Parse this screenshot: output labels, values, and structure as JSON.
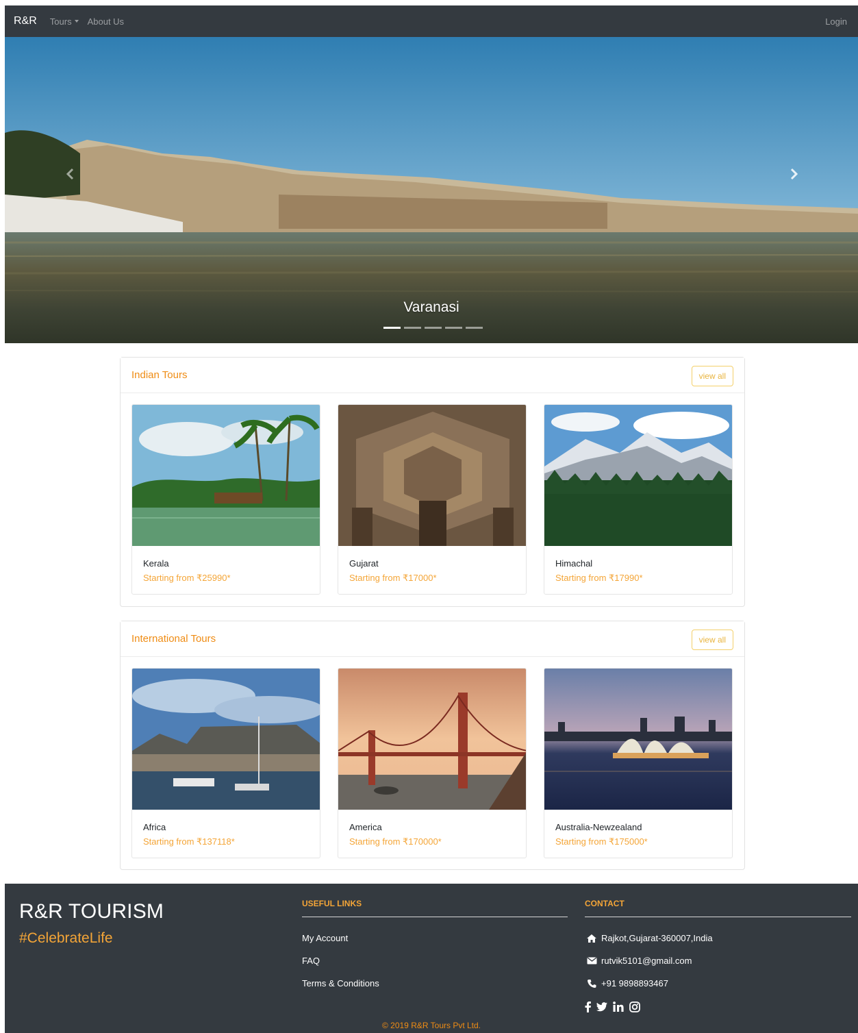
{
  "nav": {
    "brand": "R&R",
    "items": [
      {
        "label": "Tours",
        "dropdown": true
      },
      {
        "label": "About Us"
      }
    ],
    "login": "Login"
  },
  "hero": {
    "caption": "Varanasi",
    "slides_count": 5,
    "active_slide": 1,
    "prev_icon": "chevron-left-icon",
    "next_icon": "chevron-right-icon"
  },
  "indian_tours": {
    "title": "Indian Tours",
    "view_all": "view all",
    "items": [
      {
        "name": "Kerala",
        "price": "Starting from ₹25990*"
      },
      {
        "name": "Gujarat",
        "price": "Starting from ₹17000*"
      },
      {
        "name": "Himachal",
        "price": "Starting from ₹17990*"
      }
    ]
  },
  "international_tours": {
    "title": "International Tours",
    "view_all": "view all",
    "items": [
      {
        "name": "Africa",
        "price": "Starting from ₹137118*"
      },
      {
        "name": "America",
        "price": "Starting from ₹170000*"
      },
      {
        "name": "Australia-Newzealand",
        "price": "Starting from ₹175000*"
      }
    ]
  },
  "footer": {
    "brand": "R&R TOURISM",
    "tagline": "#CelebrateLife",
    "useful_links": {
      "heading": "USEFUL LINKS",
      "items": [
        "My Account",
        "FAQ",
        "Terms & Conditions"
      ]
    },
    "contact": {
      "heading": "CONTACT",
      "address": "Rajkot,Gujarat-360007,India",
      "email": "rutvik5101@gmail.com",
      "phone": "+91 9898893467"
    },
    "social_icons": [
      "facebook-icon",
      "twitter-icon",
      "linkedin-icon",
      "instagram-icon"
    ],
    "copyright": "© 2019 R&R Tours Pvt Ltd."
  },
  "colors": {
    "navbar": "#343a40",
    "accent_orange": "#ef8c14",
    "price_orange": "#f4a537"
  }
}
